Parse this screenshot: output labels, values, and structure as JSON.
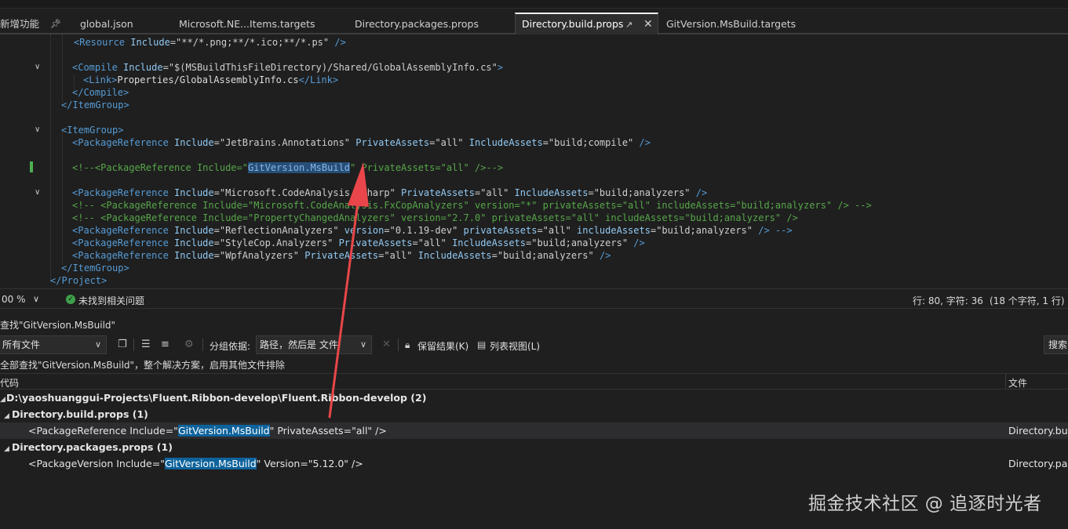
{
  "tabs": {
    "new_feature_label": "新增功能",
    "items": [
      {
        "label": "global.json"
      },
      {
        "label": "Microsoft.NE...Items.targets"
      },
      {
        "label": "Directory.packages.props"
      },
      {
        "label": "Directory.build.props"
      },
      {
        "label": "GitVersion.MsBuild.targets"
      }
    ]
  },
  "editor": {
    "lines": [
      {
        "pre": "<",
        "tag": "Resource",
        "a1": " Include",
        "v1": "=\"**/*.png;**/*.ico;**/*.ps\"",
        "post": " />"
      },
      {
        "blank": true
      },
      {
        "pre": "<",
        "tag": "Compile",
        "a1": " Include",
        "v1": "=\"$(MSBuildThisFileDirectory)/Shared/GlobalAssemblyInfo.cs\"",
        "post": ">"
      },
      {
        "pre": "<",
        "tag": "Link",
        "mid": ">",
        "text": "Properties/GlobalAssemblyInfo.cs",
        "close": "</Link>"
      },
      {
        "pre": "</",
        "tag": "Compile",
        "post": ">"
      },
      {
        "pre": "</",
        "tag": "ItemGroup",
        "post": ">"
      },
      {
        "blank": true
      },
      {
        "pre": "<",
        "tag": "ItemGroup",
        "post": ">"
      },
      {
        "pre": "<",
        "tag": "PackageReference",
        "a1": " Include",
        "v1": "=\"JetBrains.Annotations\"",
        "a2": " PrivateAssets",
        "v2": "=\"all\"",
        "a3": " IncludeAssets",
        "v3": "=\"build;compile\"",
        "post": " />"
      },
      {
        "blank": true
      },
      {
        "comment_open": "<!--<",
        "tag": "PackageReference",
        "a1": " Include",
        "v1_pre": "=\"",
        "hl": "GitVersion.MsBuild",
        "v1_post": "\"",
        "a2": " PrivateAssets",
        "v2": "=\"all\"",
        "post": " />-->"
      },
      {
        "blank": true
      },
      {
        "pre": "<",
        "tag": "PackageReference",
        "a1": " Include",
        "v1": "=\"Microsoft.CodeAnalysis.CSharp\"",
        "a2": " PrivateAssets",
        "v2": "=\"all\"",
        "a3": " IncludeAssets",
        "v3": "=\"build;analyzers\"",
        "post": " />"
      },
      {
        "comment_open": "<!-- <",
        "tag": "PackageReference",
        "a1": " Include",
        "v1": "=\"Microsoft.CodeAnalysis.FxCopAnalyzers\"",
        "a2": " version",
        "v2": "=\"*\"",
        "a3": " privateAssets",
        "v3": "=\"all\"",
        "a4": " includeAssets",
        "v4": "=\"build;analyzers\"",
        "post": " /> -->"
      },
      {
        "comment_open": "<!-- <",
        "tag": "PackageReference",
        "a1": " Include",
        "v1": "=\"PropertyChangedAnalyzers\"",
        "a2": " version",
        "v2": "=\"2.7.0\"",
        "a3": " privateAssets",
        "v3": "=\"all\"",
        "a4": " includeAssets",
        "v4": "=\"build;analyzers\"",
        "post": " />"
      },
      {
        "pre": "<",
        "tag": "PackageReference",
        "a1": " Include",
        "v1": "=\"ReflectionAnalyzers\"",
        "a2": " version",
        "v2": "=\"0.1.19-dev\"",
        "a3": " privateAssets",
        "v3": "=\"all\"",
        "a4": " includeAssets",
        "v4": "=\"build;analyzers\"",
        "post": " /> -->"
      },
      {
        "pre": "<",
        "tag": "PackageReference",
        "a1": " Include",
        "v1": "=\"StyleCop.Analyzers\"",
        "a2": " PrivateAssets",
        "v2": "=\"all\"",
        "a3": " IncludeAssets",
        "v3": "=\"build;analyzers\"",
        "post": " />"
      },
      {
        "pre": "<",
        "tag": "PackageReference",
        "a1": " Include",
        "v1": "=\"WpfAnalyzers\"",
        "a2": " PrivateAssets",
        "v2": "=\"all\"",
        "a3": " IncludeAssets",
        "v3": "=\"build;analyzers\"",
        "post": " />"
      },
      {
        "pre": "</",
        "tag": "ItemGroup",
        "post": ">"
      },
      {
        "pre": "</",
        "tag": "Project",
        "post": ">"
      }
    ]
  },
  "statusbar": {
    "zoom": "00 %",
    "issues": "未找到相关问题",
    "position": "行: 80, 字符: 36",
    "selection": "(18 个字符, 1 行)"
  },
  "find_panel": {
    "title": "查找\"GitVersion.MsBuild\"",
    "scope_dropdown": "所有文件",
    "group_by_label": "分组依据:",
    "group_by_value": "路径，然后是 文件",
    "keep_results": "保留结果(K)",
    "list_view": "列表视图(L)",
    "search_button": "搜索",
    "scope_text": "全部查找\"GitVersion.MsBuild\"，整个解决方案，启用其他文件排除",
    "col_code": "代码",
    "col_file": "文件",
    "root_path": "D:\\yaoshuanggui-Projects\\Fluent.Ribbon-develop\\Fluent.Ribbon-develop (2)",
    "groups": [
      {
        "name": "Directory.build.props (1)",
        "result_pre": "<PackageReference Include=\"",
        "result_match": "GitVersion.MsBuild",
        "result_post": "\" PrivateAssets=\"all\" />",
        "file": "Directory.buil"
      },
      {
        "name": "Directory.packages.props (1)",
        "result_pre": "<PackageVersion Include=\"",
        "result_match": "GitVersion.MsBuild",
        "result_post": "\" Version=\"5.12.0\" />",
        "file": "Directory.pac"
      }
    ]
  },
  "watermark": "掘金技术社区 @ 追逐时光者",
  "colors": {
    "annotation_arrow": "#e8464a",
    "match_highlight": "#0e639c",
    "editor_highlight": "#264f78",
    "ok_icon": "#3ea04a"
  },
  "icons": [
    "pin-icon",
    "close-icon",
    "fold-chevron-icon",
    "ok-check-icon",
    "chevron-down-icon",
    "copy-icon",
    "collapse-all-icon",
    "expand-all-icon",
    "filter-icon",
    "clear-icon",
    "lock-icon",
    "list-view-icon"
  ]
}
